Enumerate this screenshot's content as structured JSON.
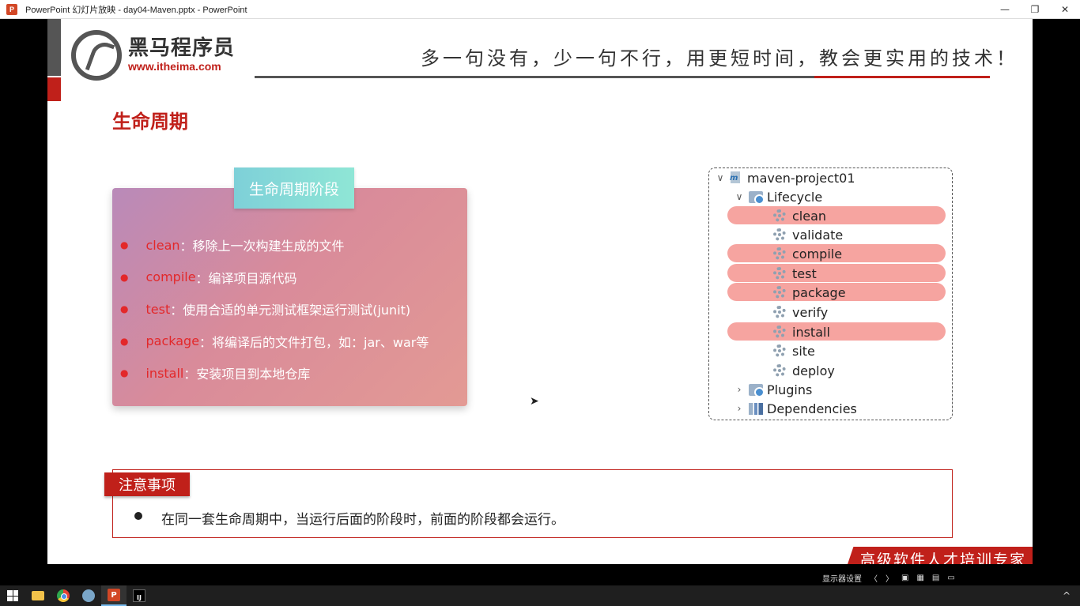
{
  "window": {
    "app_icon_label": "P",
    "title": "PowerPoint 幻灯片放映  -  day04-Maven.pptx - PowerPoint",
    "minimize": "—",
    "restore": "❐",
    "close": "✕"
  },
  "slide": {
    "logo": {
      "cn": "黑马程序员",
      "url": "www.itheima.com"
    },
    "slogan": "多一句没有，少一句不行，用更短时间，教会更实用的技术！",
    "title": "生命周期",
    "phases_tag": "生命周期阶段",
    "phases": [
      {
        "name": "clean",
        "desc": "：移除上一次构建生成的文件"
      },
      {
        "name": "compile",
        "desc": "：编译项目源代码"
      },
      {
        "name": "test",
        "desc": "：使用合适的单元测试框架运行测试(junit)"
      },
      {
        "name": "package",
        "desc": "：将编译后的文件打包，如：jar、war等"
      },
      {
        "name": "install",
        "desc": "：安装项目到本地仓库"
      }
    ],
    "tree": {
      "project": "maven-project01",
      "lifecycle": "Lifecycle",
      "phases": [
        {
          "label": "clean",
          "highlighted": true
        },
        {
          "label": "validate",
          "highlighted": false
        },
        {
          "label": "compile",
          "highlighted": true
        },
        {
          "label": "test",
          "highlighted": true
        },
        {
          "label": "package",
          "highlighted": true
        },
        {
          "label": "verify",
          "highlighted": false
        },
        {
          "label": "install",
          "highlighted": true
        },
        {
          "label": "site",
          "highlighted": false
        },
        {
          "label": "deploy",
          "highlighted": false
        }
      ],
      "plugins": "Plugins",
      "dependencies": "Dependencies"
    },
    "notice_tag": "注意事项",
    "notice_text": "在同一套生命周期中，当运行后面的阶段时，前面的阶段都会运行。",
    "footer": "高级软件人才培训专家"
  },
  "controls": {
    "display_settings": "显示器设置",
    "prev": "〈",
    "next": "〉",
    "normal_view": "▣",
    "slide_sorter": "▦",
    "reading_view": "▤",
    "slideshow": "▭"
  },
  "taskbar": {
    "ppt_label": "P",
    "intellij_label": "IJ",
    "tray_chevron": "^"
  },
  "colors": {
    "brand_red": "#c0201a",
    "highlight": "#f6a4a0",
    "tag_teal": "#7ed0d8"
  }
}
